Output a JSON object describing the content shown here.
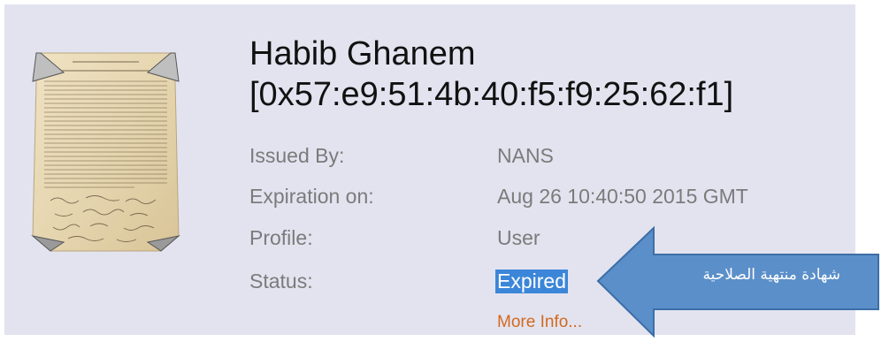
{
  "certificate": {
    "name": "Habib Ghanem",
    "serial": "[0x57:e9:51:4b:40:f5:f9:25:62:f1]",
    "fields": [
      {
        "label": "Issued By:",
        "value": "NANS"
      },
      {
        "label": "Expiration on:",
        "value": "Aug 26 10:40:50 2015 GMT"
      },
      {
        "label": "Profile:",
        "value": "User"
      },
      {
        "label": "Status:",
        "value": "Expired"
      }
    ],
    "more_info": "More Info...",
    "icon": "declaration-document-icon"
  },
  "callout": {
    "text": "شهادة منتهية الصلاحية",
    "color": "#5b8fc9"
  },
  "colors": {
    "panel": "#e3e3f0",
    "status_highlight": "#3b86d8",
    "link": "#d2691e"
  }
}
